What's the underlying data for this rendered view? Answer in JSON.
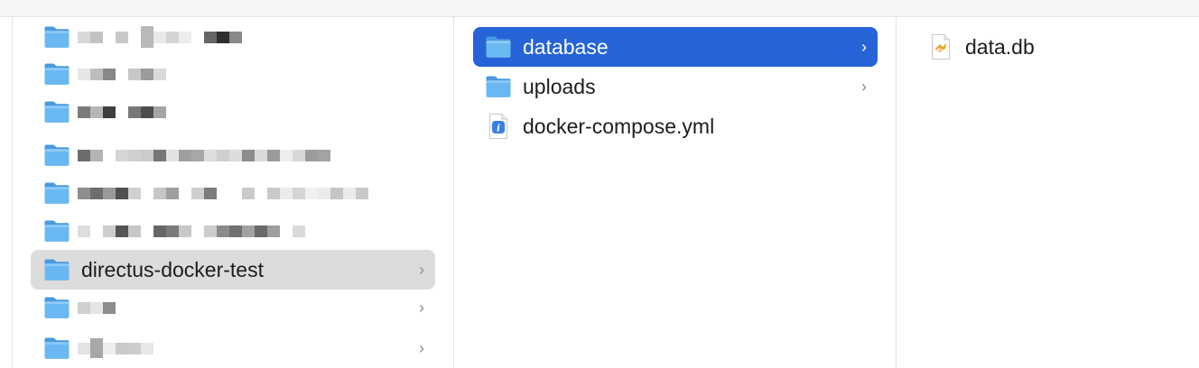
{
  "column1": {
    "items": [
      {
        "type": "folder",
        "redacted": true
      },
      {
        "type": "folder",
        "redacted": true
      },
      {
        "type": "folder",
        "redacted": true
      },
      {
        "type": "folder",
        "redacted": true
      },
      {
        "type": "folder",
        "redacted": true
      },
      {
        "type": "folder",
        "redacted": true
      },
      {
        "type": "folder",
        "label": "directus-docker-test",
        "state": "inactive-selected",
        "has_children": true
      },
      {
        "type": "folder",
        "redacted": true,
        "has_children": true
      },
      {
        "type": "folder",
        "redacted": true,
        "has_children": true
      }
    ]
  },
  "column2": {
    "items": [
      {
        "type": "folder",
        "label": "database",
        "state": "selected",
        "has_children": true
      },
      {
        "type": "folder",
        "label": "uploads",
        "has_children": true
      },
      {
        "type": "file",
        "label": "docker-compose.yml",
        "icon": "yaml-file-icon"
      }
    ]
  },
  "column3": {
    "items": [
      {
        "type": "file",
        "label": "data.db",
        "icon": "database-file-icon"
      }
    ]
  },
  "colors": {
    "selection_blue": "#2663d6",
    "inactive_selection": "#dcdcdc",
    "folder_blue": "#63b1ee",
    "chevron_gray": "#8e8e93"
  },
  "glyphs": {
    "chevron": "›"
  }
}
